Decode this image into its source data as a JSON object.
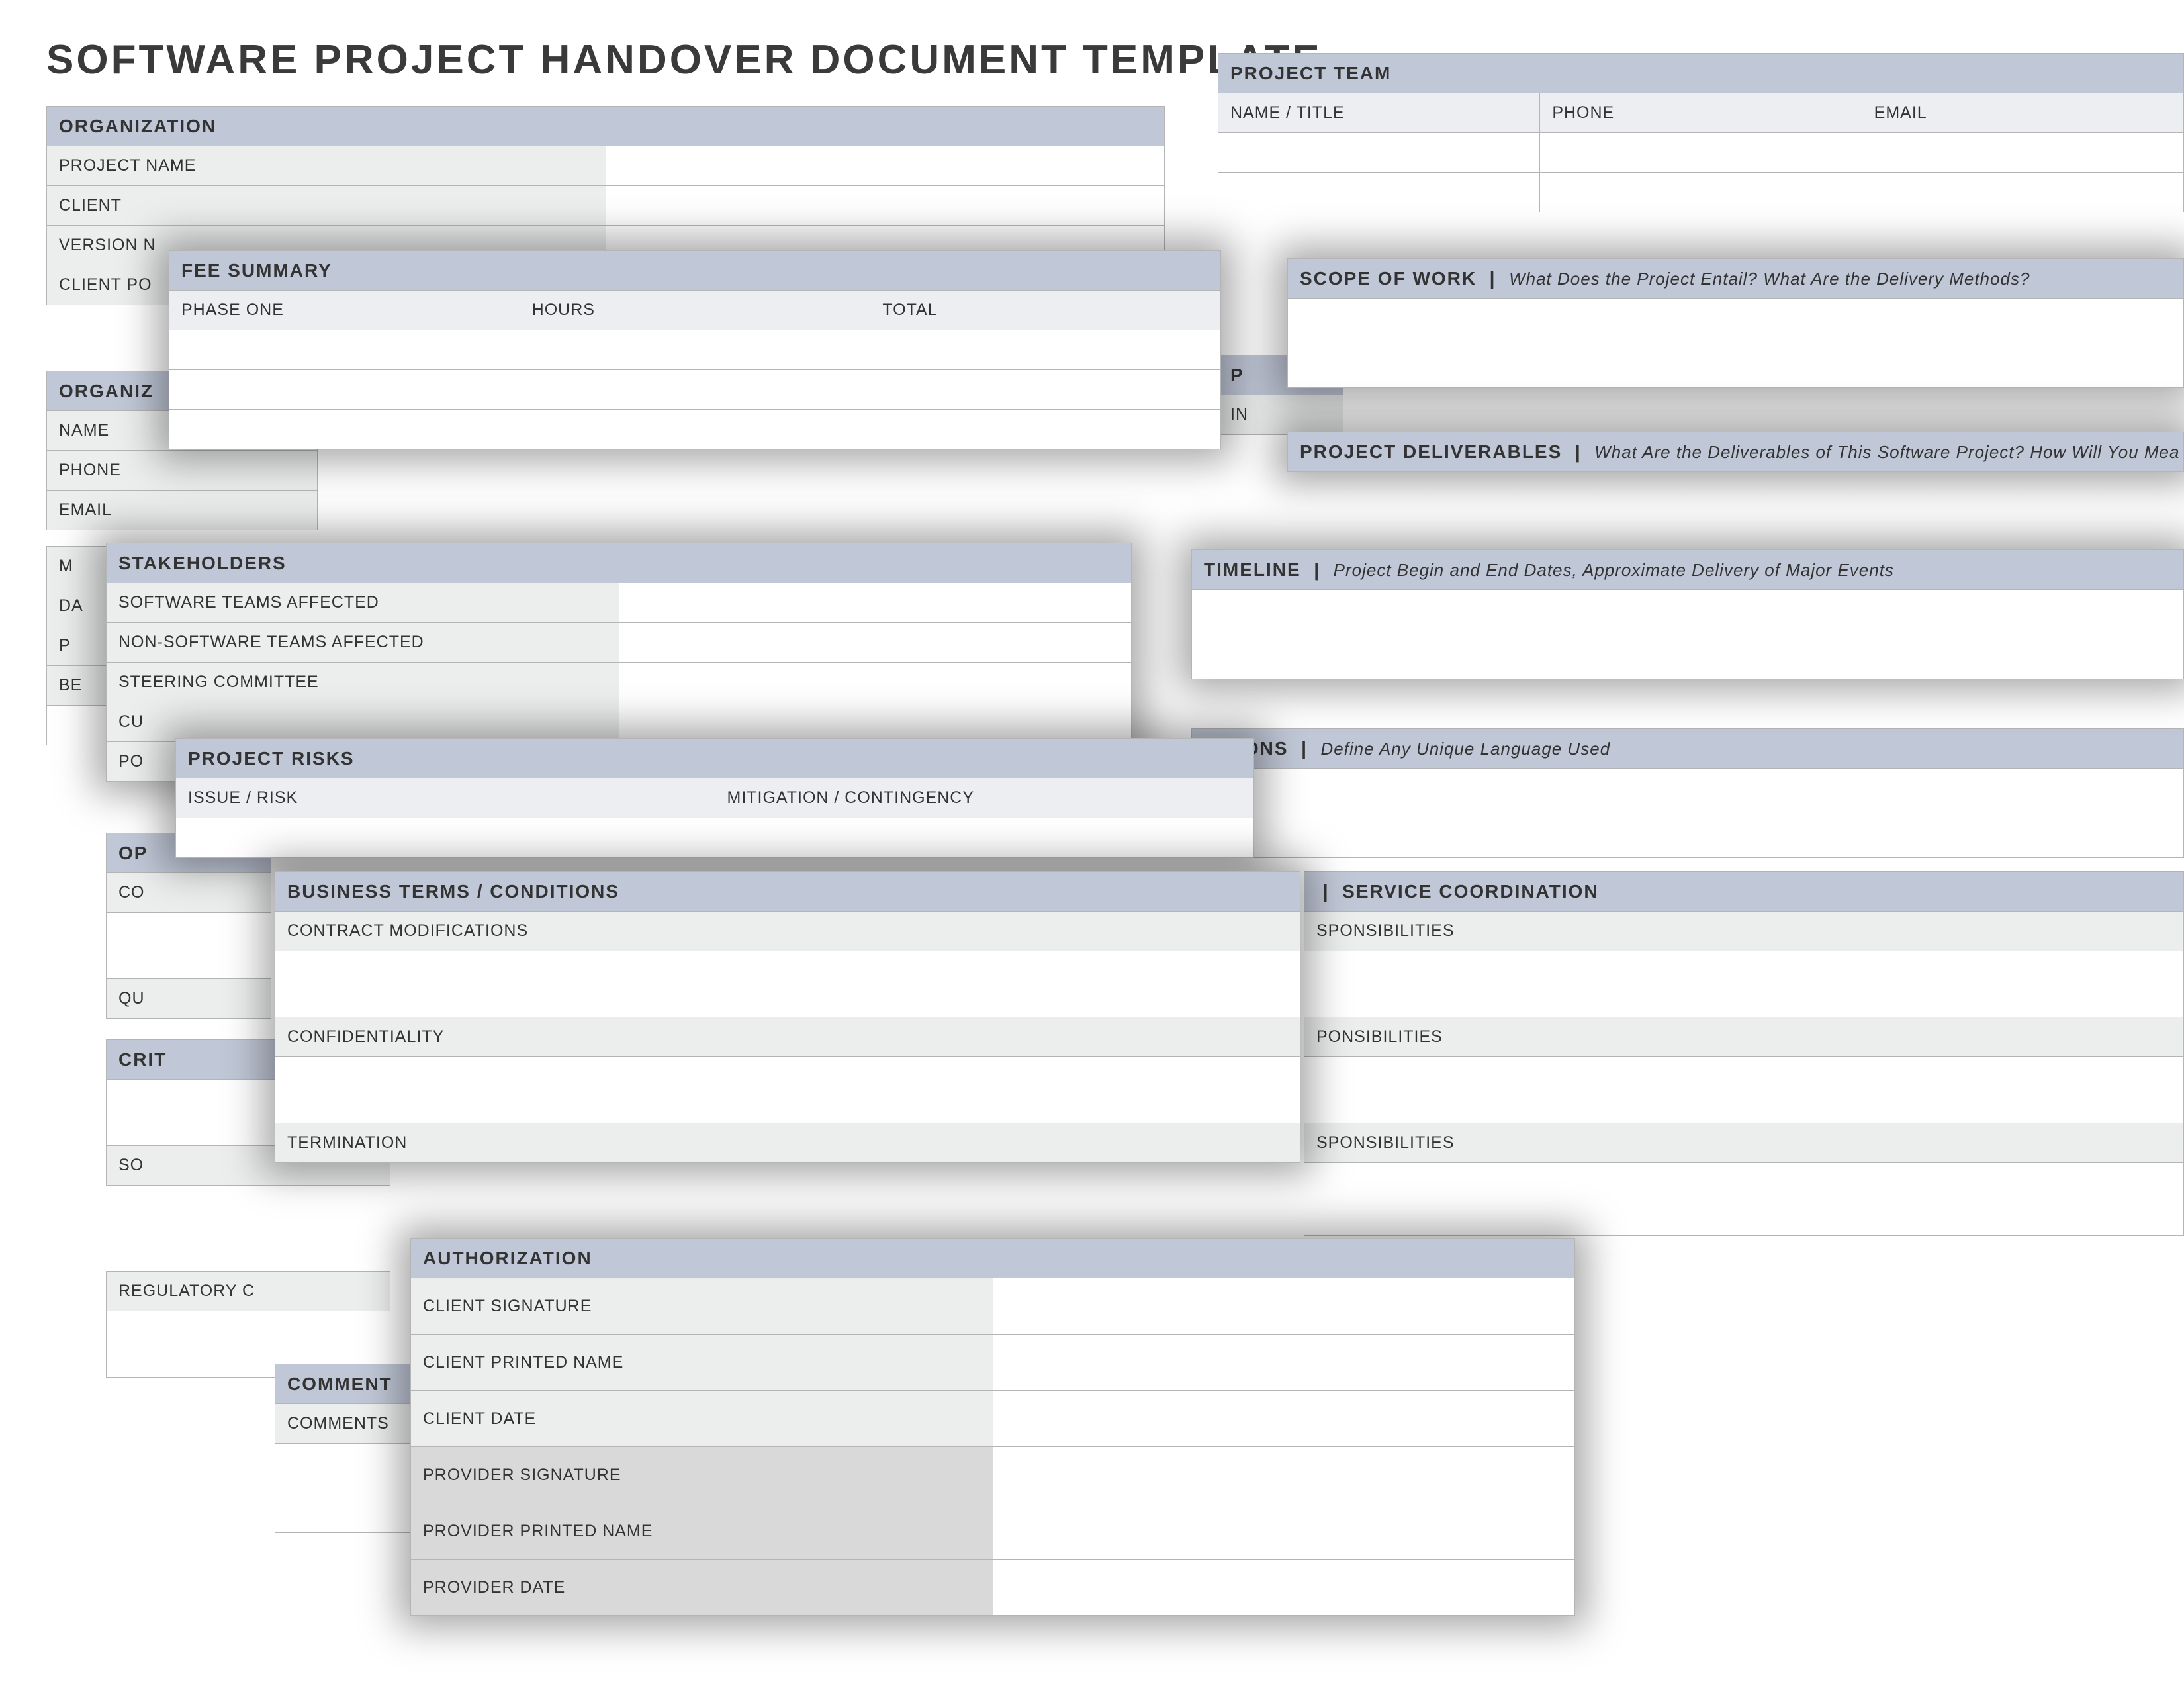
{
  "title": "SOFTWARE PROJECT HANDOVER DOCUMENT TEMPLATE",
  "org": {
    "header": "ORGANIZATION",
    "rows": [
      "PROJECT NAME",
      "CLIENT",
      "VERSION N",
      "CLIENT PO"
    ]
  },
  "org_contact": {
    "header": "ORGANIZ",
    "rows": [
      "NAME",
      "PHONE",
      "EMAIL",
      "M",
      "DA",
      "P",
      "BE"
    ]
  },
  "team": {
    "header": "PROJECT TEAM",
    "cols": [
      "NAME / TITLE",
      "PHONE",
      "EMAIL"
    ]
  },
  "scope": {
    "h": "SCOPE OF WORK",
    "s": "What Does the Project Entail? What Are the Delivery Methods?"
  },
  "deliverables": {
    "h": "PROJECT DELIVERABLES",
    "s": "What Are the Deliverables of This Software Project? How Will You Mea"
  },
  "p": {
    "h": "P",
    "row": "IN"
  },
  "timeline": {
    "h": "TIMELINE",
    "s": "Project Begin and End Dates, Approximate Delivery of Major Events"
  },
  "defs": {
    "h": "NITIONS",
    "s": "Define Any Unique Language Used"
  },
  "fee": {
    "h": "FEE SUMMARY",
    "cols": [
      "PHASE ONE",
      "HOURS",
      "TOTAL"
    ]
  },
  "stake": {
    "h": "STAKEHOLDERS",
    "rows": [
      "SOFTWARE TEAMS AFFECTED",
      "NON-SOFTWARE TEAMS AFFECTED",
      "STEERING COMMITTEE",
      "CU",
      "PO"
    ]
  },
  "risks": {
    "h": "PROJECT RISKS",
    "cols": [
      "ISSUE / RISK",
      "MITIGATION / CONTINGENCY"
    ]
  },
  "misc": {
    "op": "OP",
    "co": "CO",
    "qu": "QU",
    "crit": "CRIT",
    "so": "SO",
    "reg": "REGULATORY C",
    "comment_h": "COMMENT",
    "comments": "COMMENTS"
  },
  "biz": {
    "h": "BUSINESS TERMS / CONDITIONS",
    "rows": [
      "CONTRACT MODIFICATIONS",
      "CONFIDENTIALITY",
      "TERMINATION"
    ]
  },
  "svc": {
    "h": "SERVICE COORDINATION",
    "rows": [
      "SPONSIBILITIES",
      "PONSIBILITIES",
      "SPONSIBILITIES"
    ]
  },
  "auth": {
    "h": "AUTHORIZATION",
    "client": [
      "CLIENT SIGNATURE",
      "CLIENT PRINTED NAME",
      "CLIENT DATE"
    ],
    "provider": [
      "PROVIDER SIGNATURE",
      "PROVIDER PRINTED NAME",
      "PROVIDER DATE"
    ]
  }
}
